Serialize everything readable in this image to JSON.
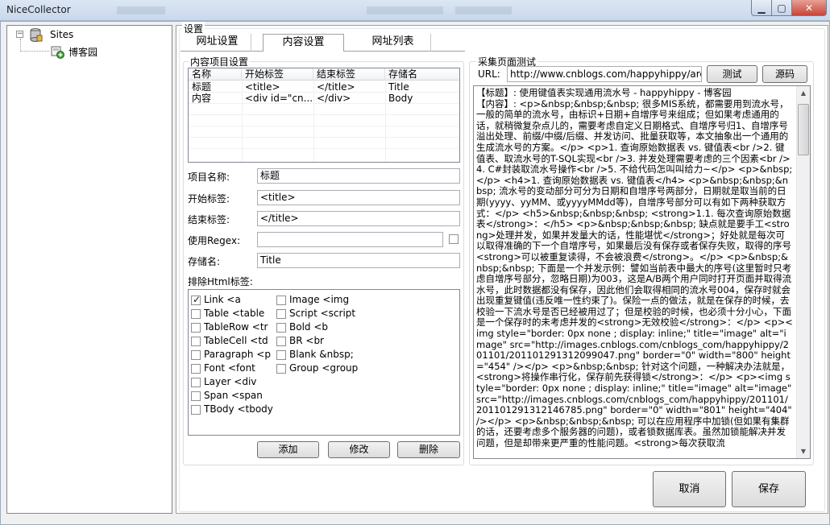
{
  "window": {
    "title": "NiceCollector"
  },
  "tree": {
    "root_label": "Sites",
    "root_expander": "−",
    "child_label": "博客园"
  },
  "settings": {
    "group_title": "设置",
    "tabs": [
      {
        "label": "网址设置",
        "active": false
      },
      {
        "label": "内容设置",
        "active": true
      },
      {
        "label": "网址列表",
        "active": false
      }
    ]
  },
  "content_items": {
    "group_title": "内容项目设置",
    "columns": [
      "名称",
      "开始标签",
      "结束标签",
      "存储名"
    ],
    "rows": [
      [
        "标题",
        "<title>",
        "</title>",
        "Title"
      ],
      [
        "内容",
        "<div id=\"cn...",
        "</div>",
        "Body"
      ]
    ]
  },
  "form": {
    "item_name_label": "项目名称:",
    "item_name_value": "标题",
    "start_tag_label": "开始标签:",
    "start_tag_value": "<title>",
    "end_tag_label": "结束标签:",
    "end_tag_value": "</title>",
    "regex_label": "使用Regex:",
    "regex_value": "",
    "regex_checked": false,
    "store_name_label": "存储名:",
    "store_name_value": "Title",
    "exclude_label": "排除Html标签:"
  },
  "exclude_tags": {
    "left": [
      {
        "label": "Link <a",
        "checked": true
      },
      {
        "label": "Table <table",
        "checked": false
      },
      {
        "label": "TableRow <tr",
        "checked": false
      },
      {
        "label": "TableCell <td",
        "checked": false
      },
      {
        "label": "Paragraph <p",
        "checked": false
      },
      {
        "label": "Font <font",
        "checked": false
      },
      {
        "label": "Layer <div",
        "checked": false
      },
      {
        "label": "Span <span",
        "checked": false
      },
      {
        "label": "TBody <tbody",
        "checked": false
      }
    ],
    "right": [
      {
        "label": "Image <img",
        "checked": false
      },
      {
        "label": "Script <script",
        "checked": false
      },
      {
        "label": "Bold <b",
        "checked": false
      },
      {
        "label": "BR <br",
        "checked": false
      },
      {
        "label": "Blank &nbsp;",
        "checked": false
      },
      {
        "label": "Group <group",
        "checked": false
      }
    ]
  },
  "item_buttons": {
    "add": "添加",
    "edit": "修改",
    "delete": "删除"
  },
  "test_panel": {
    "group_title": "采集页面测试",
    "url_label": "URL:",
    "url_value": "http://www.cnblogs.com/happyhippy/arcl",
    "test_button": "测试",
    "source_button": "源码",
    "result_text": "【标题】: 使用键值表实现通用流水号 - happyhippy - 博客园\n【内容】: <p>&nbsp;&nbsp;&nbsp; 很多MIS系统，都需要用到流水号，一般的简单的流水号，由标识+日期+自增序号来组成；但如果考虑通用的话，就稍微复杂点儿的，需要考虑自定义日期格式、自增序号归1、自增序号溢出处理、前缀/中缀/后缀、并发访问、批量获取等，本文抽象出一个通用的生成流水号的方案。</p> <p>1. 查询原始数据表 vs. 键值表<br />2. 键值表、取流水号的T-SQL实现<br />3. 并发处理需要考虑的三个因素<br />4. C#封装取流水号操作<br />5. 不给代码怎叫叫给力~</p> <p>&nbsp;</p> <h4>1. 查询原始数据表 vs. 键值表</h4> <p>&nbsp;&nbsp;&nbsp; 流水号的变动部分可分为日期和自增序号两部分，日期就是取当前的日期(yyyy、yyMM、或yyyyMMdd等)，自增序号部分可以有如下两种获取方式：</p> <h5>&nbsp;&nbsp;&nbsp; <strong>1.1. 每次查询原始数据表</strong>：</h5> <p>&nbsp;&nbsp;&nbsp; 缺点就是要手工<strong>处理并发，如果并发量大的话，性能堪忧</strong>；好处就是每次可以取得准确的下一个自增序号，如果最后没有保存或者保存失败，取得的序号<strong>可以被重复读得，不会被浪费</strong>。</p> <p>&nbsp;&nbsp;&nbsp; 下面是一个并发示例：譬如当前表中最大的序号(这里暂时只考虑自增序号部分，忽略日期)为003，这是A/B两个用户同时打开页面并取得流水号，此时数据都没有保存，因此他们会取得相同的流水号004，保存时就会出现重复键值(违反唯一性约束了)。保险一点的做法，就是在保存的时候，去校验一下流水号是否已经被用过了；但是校验的时候，也必须十分小心，下面是一个保存时的未考虑并发的<strong>无效校验</strong>：</p> <p><img style=\"border: 0px none ; display: inline;\" title=\"image\" alt=\"image\" src=\"http://images.cnblogs.com/cnblogs_com/happyhippy/201101/201101291312099047.png\" border=\"0\" width=\"800\" height=\"454\" /></p> <p>&nbsp;&nbsp; 针对这个问题，一种解决办法就是，<strong>将操作串行化，保存前先获得锁</strong>：</p> <p><img style=\"border: 0px none ; display: inline;\" title=\"image\" alt=\"image\" src=\"http://images.cnblogs.com/cnblogs_com/happyhippy/201101/201101291312146785.png\" border=\"0\" width=\"801\" height=\"404\" /></p> <p>&nbsp;&nbsp;&nbsp; 可以在应用程序中加锁(但如果有集群的话，还要考虑多个服务器的问题)，或者锁数据库表。虽然加锁能解决并发问题，但是却带来更严重的性能问题。<strong>每次获取流"
  },
  "dialog_buttons": {
    "cancel": "取消",
    "save": "保存"
  }
}
